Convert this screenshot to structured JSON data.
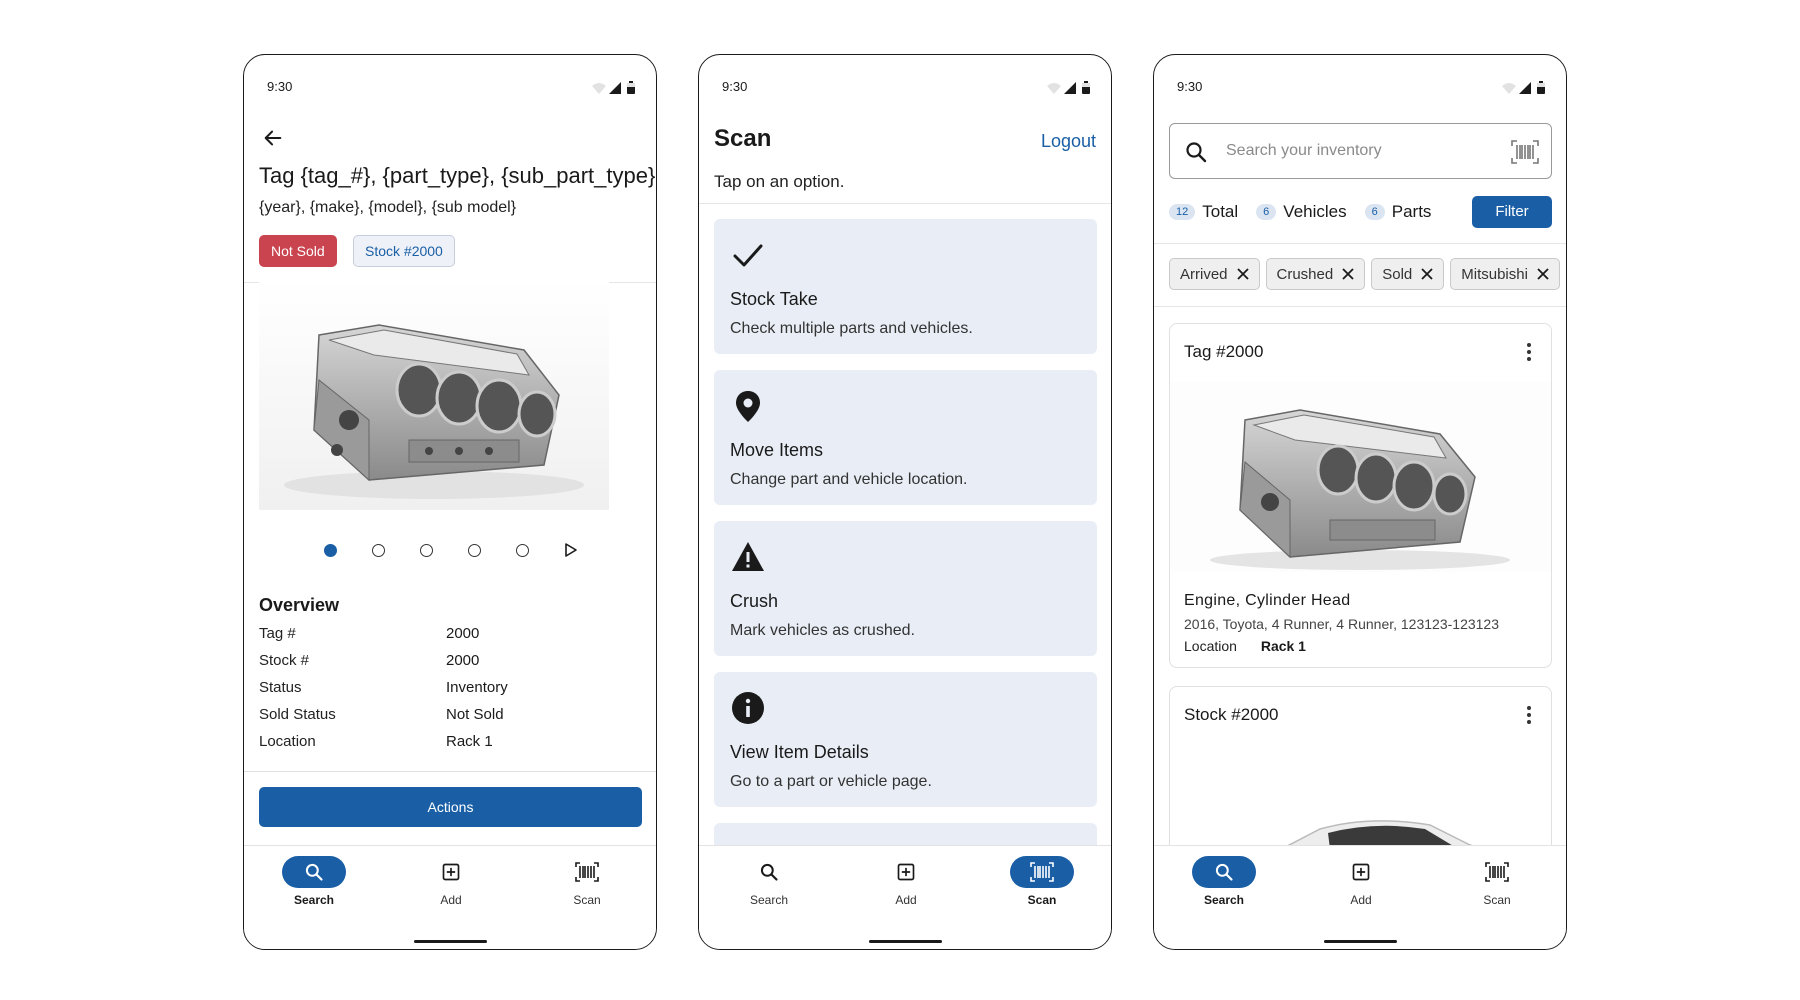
{
  "status": {
    "time": "9:30"
  },
  "nav": {
    "search": "Search",
    "add": "Add",
    "scan": "Scan"
  },
  "detail": {
    "title": "Tag {tag_#}, {part_type}, {sub_part_type}",
    "subtitle": "{year}, {make}, {model}, {sub model}",
    "badge_sold": "Not Sold",
    "badge_stock": "Stock #2000",
    "carousel_count": 5,
    "carousel_active": 1,
    "overview_title": "Overview",
    "overview": [
      {
        "key": "Tag #",
        "value": "2000"
      },
      {
        "key": "Stock #",
        "value": "2000"
      },
      {
        "key": "Status",
        "value": "Inventory"
      },
      {
        "key": "Sold Status",
        "value": "Not Sold"
      },
      {
        "key": "Location",
        "value": "Rack 1"
      }
    ],
    "actions_label": "Actions"
  },
  "scan": {
    "title": "Scan",
    "logout": "Logout",
    "subtitle": "Tap on an option.",
    "options": [
      {
        "icon": "check-icon",
        "title": "Stock Take",
        "desc": "Check multiple parts and vehicles."
      },
      {
        "icon": "location-pin-icon",
        "title": "Move Items",
        "desc": "Change part and vehicle location."
      },
      {
        "icon": "warning-icon",
        "title": "Crush",
        "desc": "Mark vehicles as crushed."
      },
      {
        "icon": "info-icon",
        "title": "View Item Details",
        "desc": "Go to a part or vehicle page."
      }
    ]
  },
  "inventory": {
    "search_placeholder": "Search your inventory",
    "counts": [
      {
        "count": "12",
        "label": "Total"
      },
      {
        "count": "6",
        "label": "Vehicles"
      },
      {
        "count": "6",
        "label": "Parts"
      }
    ],
    "filter_label": "Filter",
    "chips": [
      "Arrived",
      "Crushed",
      "Sold",
      "Mitsubishi"
    ],
    "cards": [
      {
        "title": "Tag #2000",
        "name": "Engine, Cylinder Head",
        "meta": "2016, Toyota, 4 Runner, 4 Runner, 123123-123123",
        "location_key": "Location",
        "location_value": "Rack 1"
      },
      {
        "title": "Stock #2000"
      }
    ]
  },
  "colors": {
    "primary": "#1a5fa6",
    "danger": "#c9444f",
    "card_bg": "#e9eef6"
  }
}
